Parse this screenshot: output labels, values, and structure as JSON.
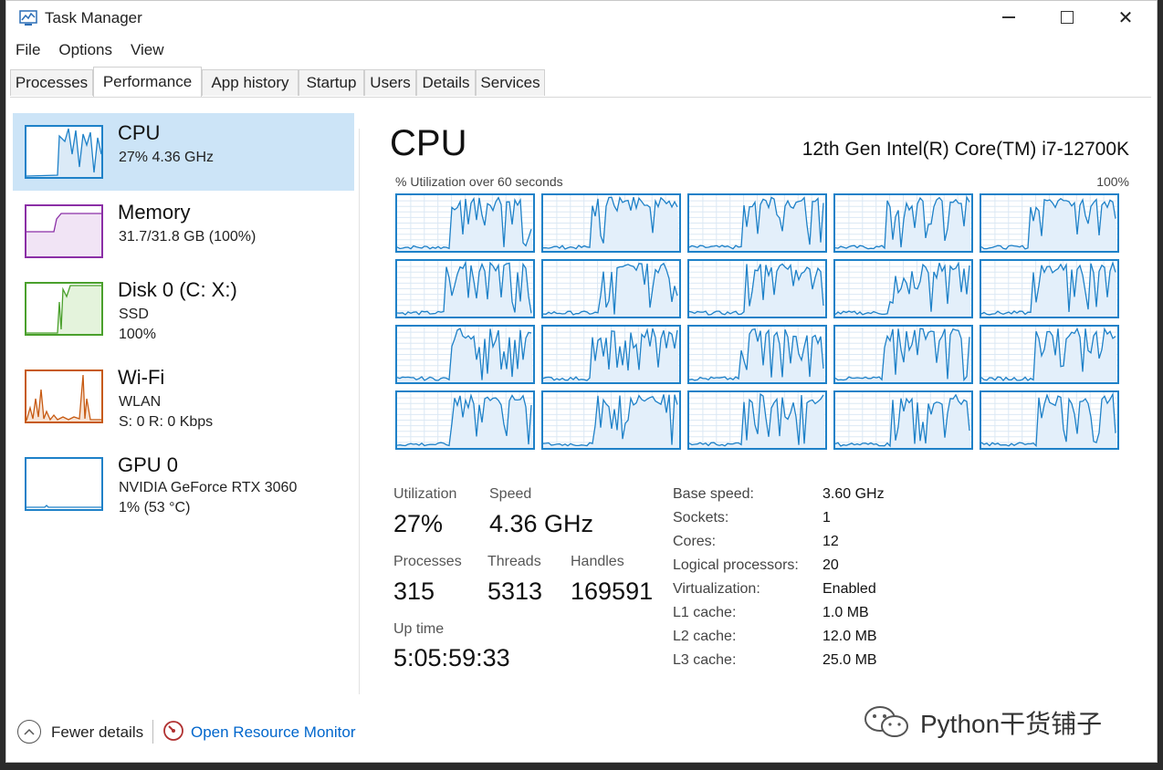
{
  "window": {
    "title": "Task Manager"
  },
  "menu": [
    "File",
    "Options",
    "View"
  ],
  "tabs": [
    {
      "label": "Processes"
    },
    {
      "label": "Performance",
      "active": true
    },
    {
      "label": "App history"
    },
    {
      "label": "Startup"
    },
    {
      "label": "Users"
    },
    {
      "label": "Details"
    },
    {
      "label": "Services"
    }
  ],
  "sidebar": {
    "items": [
      {
        "name": "CPU",
        "sub1": "27% 4.36 GHz",
        "sub2": "",
        "sub3": "",
        "color": "#1e81c8"
      },
      {
        "name": "Memory",
        "sub1": "31.7/31.8 GB (100%)",
        "sub2": "",
        "sub3": "",
        "color": "#8b2fa6"
      },
      {
        "name": "Disk 0 (C: X:)",
        "sub1": "SSD",
        "sub2": "100%",
        "sub3": "",
        "color": "#4aa02c"
      },
      {
        "name": "Wi-Fi",
        "sub1": "WLAN",
        "sub2": "S: 0 R: 0 Kbps",
        "sub3": "",
        "color": "#c75a12"
      },
      {
        "name": "GPU 0",
        "sub1": "NVIDIA GeForce RTX 3060",
        "sub2": "1% (53 °C)",
        "sub3": "",
        "color": "#1e81c8"
      }
    ]
  },
  "cpu": {
    "title": "CPU",
    "model": "12th Gen Intel(R) Core(TM) i7-12700K",
    "graph_label": "% Utilization over 60 seconds",
    "graph_max": "100%",
    "logical_graph_count": 20,
    "stats": {
      "utilization_label": "Utilization",
      "utilization": "27%",
      "speed_label": "Speed",
      "speed": "4.36 GHz",
      "processes_label": "Processes",
      "processes": "315",
      "threads_label": "Threads",
      "threads": "5313",
      "handles_label": "Handles",
      "handles": "169591",
      "uptime_label": "Up time",
      "uptime": "5:05:59:33"
    },
    "info": [
      {
        "label": "Base speed:",
        "value": "3.60 GHz"
      },
      {
        "label": "Sockets:",
        "value": "1"
      },
      {
        "label": "Cores:",
        "value": "12"
      },
      {
        "label": "Logical processors:",
        "value": "20"
      },
      {
        "label": "Virtualization:",
        "value": "Enabled"
      },
      {
        "label": "L1 cache:",
        "value": "1.0 MB"
      },
      {
        "label": "L2 cache:",
        "value": "12.0 MB"
      },
      {
        "label": "L3 cache:",
        "value": "25.0 MB"
      }
    ]
  },
  "footer": {
    "fewer_details": "Fewer details",
    "resource_monitor": "Open Resource Monitor"
  },
  "watermark": {
    "text": "Python干货铺子"
  },
  "colors": {
    "cpu": "#1e81c8",
    "memory": "#8b2fa6",
    "disk": "#4aa02c",
    "wifi": "#c75a12",
    "selected": "#cce4f7",
    "link": "#0066cc"
  }
}
